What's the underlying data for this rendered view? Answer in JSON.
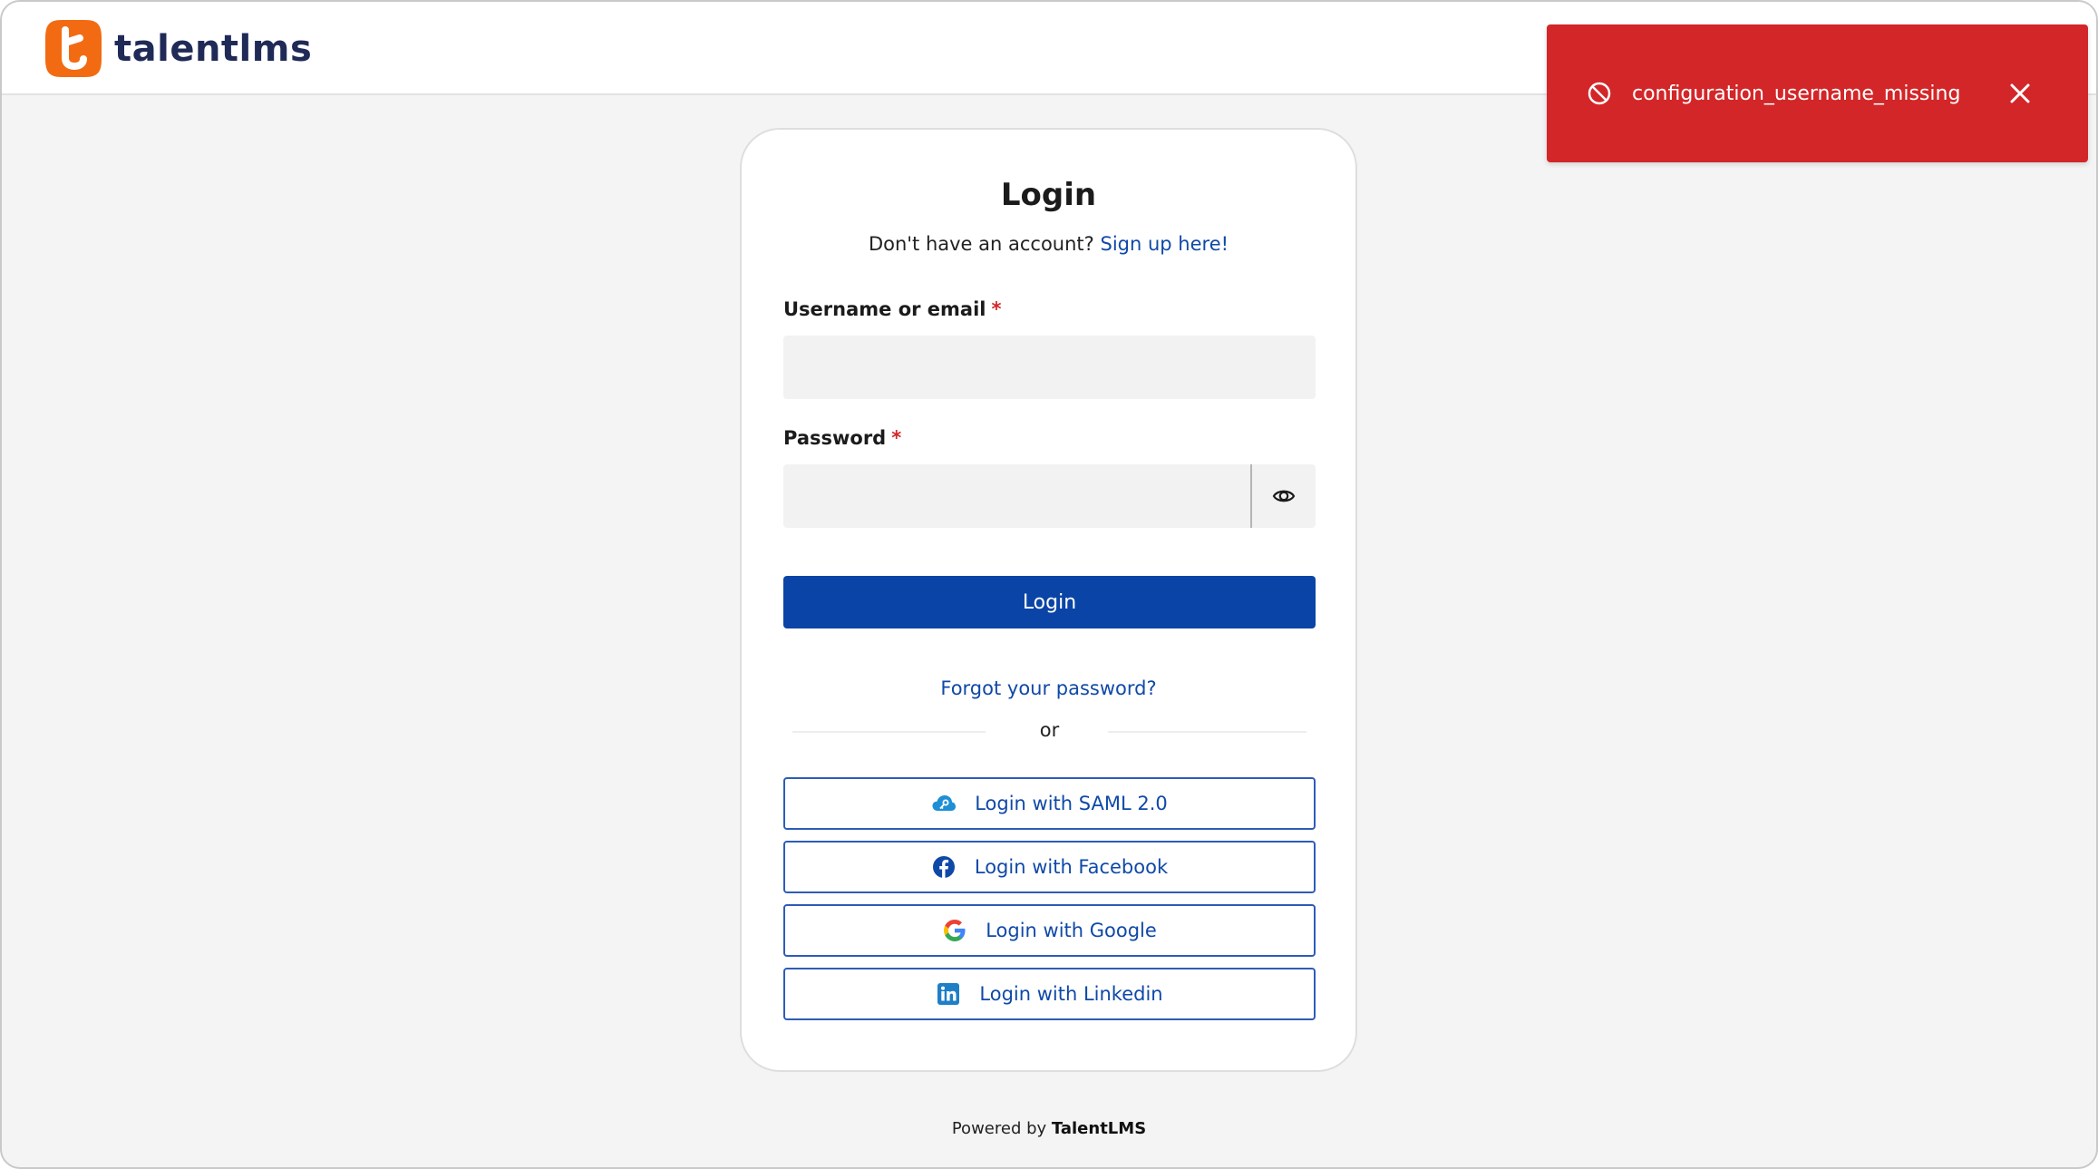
{
  "brand": {
    "name": "talentlms",
    "logo_color": "#f26b12",
    "text_color": "#1f2a57"
  },
  "toast": {
    "message": "configuration_username_missing",
    "icon": "ban-icon",
    "close_icon": "close-icon",
    "color": "#d32628"
  },
  "login": {
    "title": "Login",
    "signup_prompt": "Don't have an account?",
    "signup_link": "Sign up here!",
    "username_label": "Username or email",
    "username_value": "",
    "password_label": "Password",
    "password_value": "",
    "required_marker": "*",
    "submit_label": "Login",
    "forgot_link": "Forgot your password?",
    "divider_text": "or",
    "accent_color": "#0a44a6"
  },
  "sso": [
    {
      "label": "Login with SAML 2.0",
      "icon": "saml-cloud-key-icon"
    },
    {
      "label": "Login with Facebook",
      "icon": "facebook-icon"
    },
    {
      "label": "Login with Google",
      "icon": "google-icon"
    },
    {
      "label": "Login with Linkedin",
      "icon": "linkedin-icon"
    }
  ],
  "footer": {
    "powered_by": "Powered by",
    "brand": "TalentLMS"
  }
}
